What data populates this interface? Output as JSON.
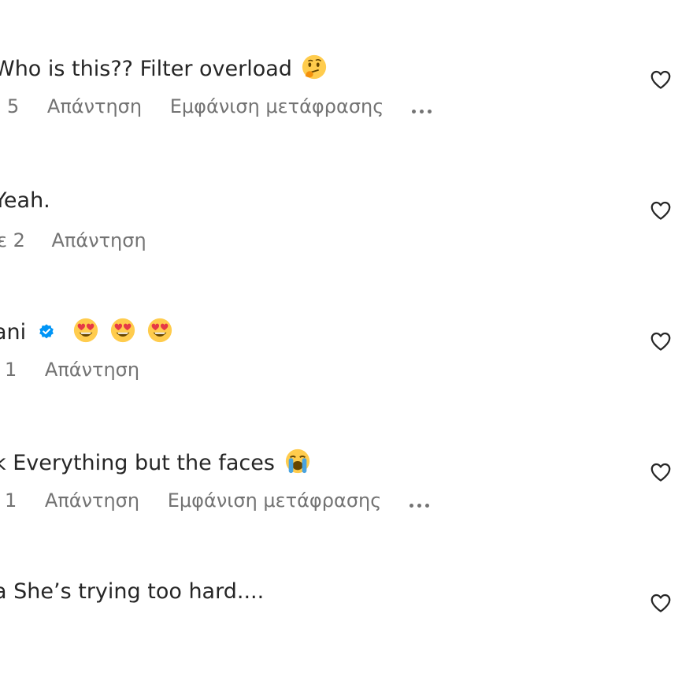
{
  "comments": [
    {
      "username_visible": "",
      "text": "Who is this?? Filter overload",
      "emoji": "thinking-face",
      "meta_prefix": "5",
      "reply_label": "Απάντηση",
      "translate_label": "Εμφάνιση μετάφρασης",
      "has_more": true
    },
    {
      "username_visible": "",
      "text": "Yeah.",
      "emoji": "",
      "meta_prefix": "ε 2",
      "reply_label": "Απάντηση",
      "translate_label": "",
      "has_more": false
    },
    {
      "username_visible": "ani",
      "verified": true,
      "text": "",
      "emoji": "heart-eyes x3",
      "meta_prefix": "1",
      "reply_label": "Απάντηση",
      "translate_label": "",
      "has_more": false
    },
    {
      "username_visible": "k",
      "text": "Everything but the faces",
      "emoji": "loudly-crying-face",
      "meta_prefix": "1",
      "reply_label": "Απάντηση",
      "translate_label": "Εμφάνιση μετάφρασης",
      "has_more": true
    },
    {
      "username_visible": "a",
      "text": "She’s trying too hard....",
      "emoji": "",
      "meta_prefix": "",
      "reply_label": "",
      "translate_label": "",
      "has_more": false
    }
  ],
  "colors": {
    "text": "#262626",
    "secondary": "#737373",
    "verified": "#0095f6",
    "emoji_yellow": "#ffcc4d",
    "heart_eye_red": "#e63946",
    "tear_blue": "#4aa3df"
  },
  "icons": {
    "like": "heart-outline-icon",
    "verified": "verified-badge-icon",
    "more": "more-options-icon"
  }
}
